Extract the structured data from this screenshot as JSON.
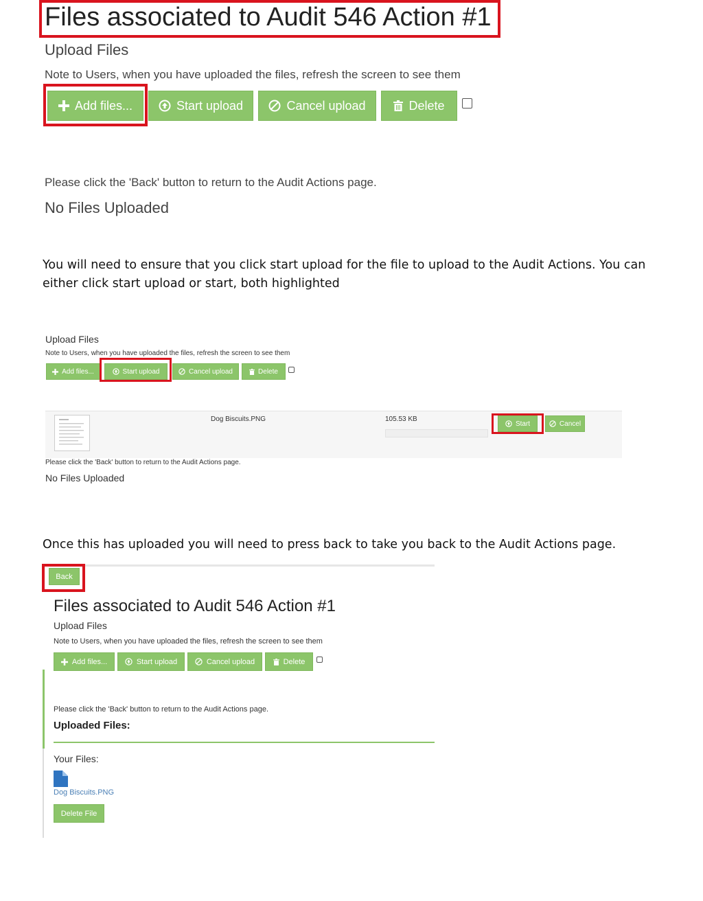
{
  "section1": {
    "title": "Files associated to Audit 546 Action #1",
    "upload_heading": "Upload Files",
    "note": "Note to Users, when you have uploaded the files, refresh the screen to see them",
    "buttons": {
      "add_files": "Add files...",
      "start_upload": "Start upload",
      "cancel_upload": "Cancel upload",
      "delete": "Delete"
    },
    "back_note": "Please click the 'Back' button to return to the Audit Actions page.",
    "no_files": "No Files Uploaded"
  },
  "instruction1": "You will need to ensure that you click start upload for the file to upload to the Audit Actions. You can either click start upload or start, both highlighted",
  "section2": {
    "upload_heading": "Upload Files",
    "note": "Note to Users, when you have uploaded the files, refresh the screen to see them",
    "buttons": {
      "add_files": "Add files...",
      "start_upload": "Start upload",
      "cancel_upload": "Cancel upload",
      "delete": "Delete"
    },
    "file_row": {
      "name": "Dog Biscuits.PNG",
      "size": "105.53 KB",
      "start": "Start",
      "cancel": "Cancel"
    },
    "back_note": "Please click the 'Back' button to return to the Audit Actions page.",
    "no_files": "No Files Uploaded"
  },
  "instruction2": "Once this has uploaded you will need to press back to take you back to the Audit Actions page.",
  "section3": {
    "back": "Back",
    "title": "Files associated to Audit 546 Action #1",
    "upload_heading": "Upload Files",
    "note": "Note to Users, when you have uploaded the files, refresh the screen to see them",
    "buttons": {
      "add_files": "Add files...",
      "start_upload": "Start upload",
      "cancel_upload": "Cancel upload",
      "delete": "Delete"
    },
    "back_note": "Please click the 'Back' button to return to the Audit Actions page.",
    "uploaded_heading": "Uploaded Files:",
    "your_files": "Your Files:",
    "file_link": "Dog Biscuits.PNG",
    "delete_file": "Delete File"
  },
  "colors": {
    "button_green": "#8cc56a",
    "highlight_red": "#d9141e",
    "link_blue": "#4a7fb5"
  },
  "icons": [
    "plus-icon",
    "upload-circle-icon",
    "ban-icon",
    "trash-icon",
    "file-icon"
  ]
}
